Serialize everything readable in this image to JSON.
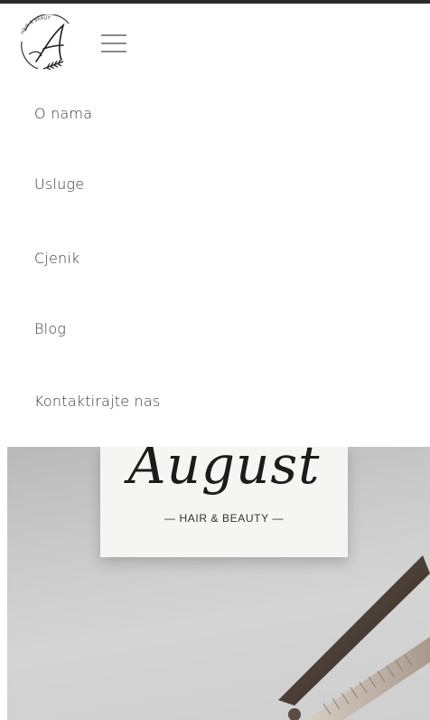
{
  "menu": {
    "items": [
      {
        "label": "O nama"
      },
      {
        "label": "Usluge"
      },
      {
        "label": "Cjenik"
      },
      {
        "label": "Blog"
      },
      {
        "label": "Kontaktirajte nas"
      }
    ]
  },
  "hero": {
    "brand_script": "August",
    "brand_sub": "— HAIR & BEAUTY —"
  },
  "logo": {
    "badge_text": "HAIR & BEAUTY"
  },
  "icons": {
    "logo": "logo-icon",
    "menu": "hamburger-menu-icon",
    "scissors": "scissors-icon"
  },
  "colors": {
    "text": "#3a3a3a",
    "top_border": "#2b2b2b",
    "card": "#f5f5f4",
    "hero_bg": "#c9c9c9"
  }
}
